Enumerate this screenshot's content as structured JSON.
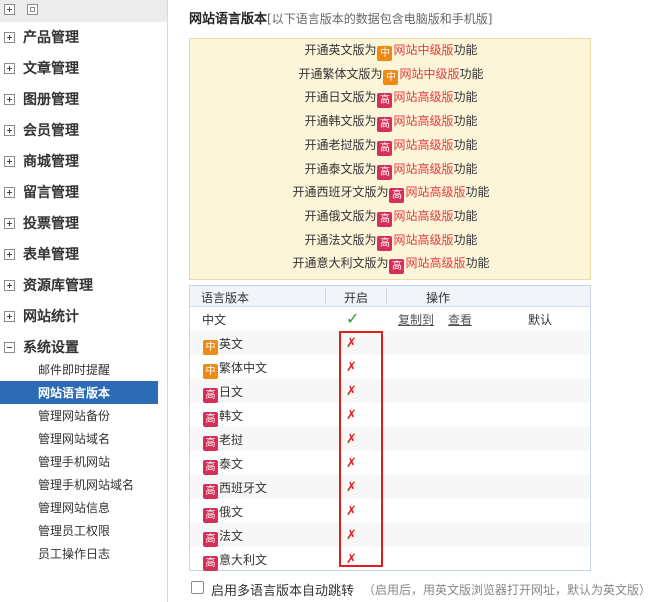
{
  "sidebar": {
    "menus": [
      {
        "label": "产品管理"
      },
      {
        "label": "文章管理"
      },
      {
        "label": "图册管理"
      },
      {
        "label": "会员管理"
      },
      {
        "label": "商城管理"
      },
      {
        "label": "留言管理"
      },
      {
        "label": "投票管理"
      },
      {
        "label": "表单管理"
      },
      {
        "label": "资源库管理"
      },
      {
        "label": "网站统计"
      },
      {
        "label": "系统设置"
      }
    ],
    "subitems": [
      {
        "label": "邮件即时提醒"
      },
      {
        "label": "网站语言版本"
      },
      {
        "label": "管理网站备份"
      },
      {
        "label": "管理网站域名"
      },
      {
        "label": "管理手机网站"
      },
      {
        "label": "管理手机网站域名"
      },
      {
        "label": "管理网站信息"
      },
      {
        "label": "管理员工权限"
      },
      {
        "label": "员工操作日志"
      }
    ],
    "active_subitem": "网站语言版本"
  },
  "page": {
    "title": "网站语言版本",
    "note": "[以下语言版本的数据包含电脑版和手机版]"
  },
  "notice": {
    "prefix": "开通",
    "verb": "版为",
    "suffix": "功能",
    "lines": [
      {
        "lang": "英文",
        "badge": "中",
        "level": "网站中级版"
      },
      {
        "lang": "繁体文",
        "badge": "中",
        "level": "网站中级版"
      },
      {
        "lang": "日文",
        "badge": "高",
        "level": "网站高级版"
      },
      {
        "lang": "韩文",
        "badge": "高",
        "level": "网站高级版"
      },
      {
        "lang": "老挝",
        "badge": "高",
        "level": "网站高级版"
      },
      {
        "lang": "泰文",
        "badge": "高",
        "level": "网站高级版"
      },
      {
        "lang": "西班牙文",
        "badge": "高",
        "level": "网站高级版"
      },
      {
        "lang": "俄文",
        "badge": "高",
        "level": "网站高级版"
      },
      {
        "lang": "法文",
        "badge": "高",
        "level": "网站高级版"
      },
      {
        "lang": "意大利文",
        "badge": "高",
        "level": "网站高级版"
      }
    ]
  },
  "table": {
    "headers": {
      "version": "语言版本",
      "enabled": "开启",
      "actions": "操作"
    },
    "rows": [
      {
        "name": "中文",
        "badge": "",
        "enabled": true,
        "copy_label": "复制到",
        "view_label": "查看",
        "default_label": "默认"
      },
      {
        "name": "英文",
        "badge": "中",
        "enabled": false
      },
      {
        "name": "繁体中文",
        "badge": "中",
        "enabled": false
      },
      {
        "name": "日文",
        "badge": "高",
        "enabled": false
      },
      {
        "name": "韩文",
        "badge": "高",
        "enabled": false
      },
      {
        "name": "老挝",
        "badge": "高",
        "enabled": false
      },
      {
        "name": "泰文",
        "badge": "高",
        "enabled": false
      },
      {
        "name": "西班牙文",
        "badge": "高",
        "enabled": false
      },
      {
        "name": "俄文",
        "badge": "高",
        "enabled": false
      },
      {
        "name": "法文",
        "badge": "高",
        "enabled": false
      },
      {
        "name": "意大利文",
        "badge": "高",
        "enabled": false
      }
    ],
    "check_glyph": "✓",
    "cross_glyph": "✗"
  },
  "auto_redirect": {
    "checked": false,
    "label": "启用多语言版本自动跳转",
    "hint": "（启用后，用英文版浏览器打开网址，默认为英文版）"
  },
  "colors": {
    "active_bg": "#2c6cb4",
    "mid_badge": "#ef8a12",
    "high_badge": "#d4305a",
    "notice_bg": "#fdf5d9",
    "highlight_box": "#e01e1e"
  }
}
